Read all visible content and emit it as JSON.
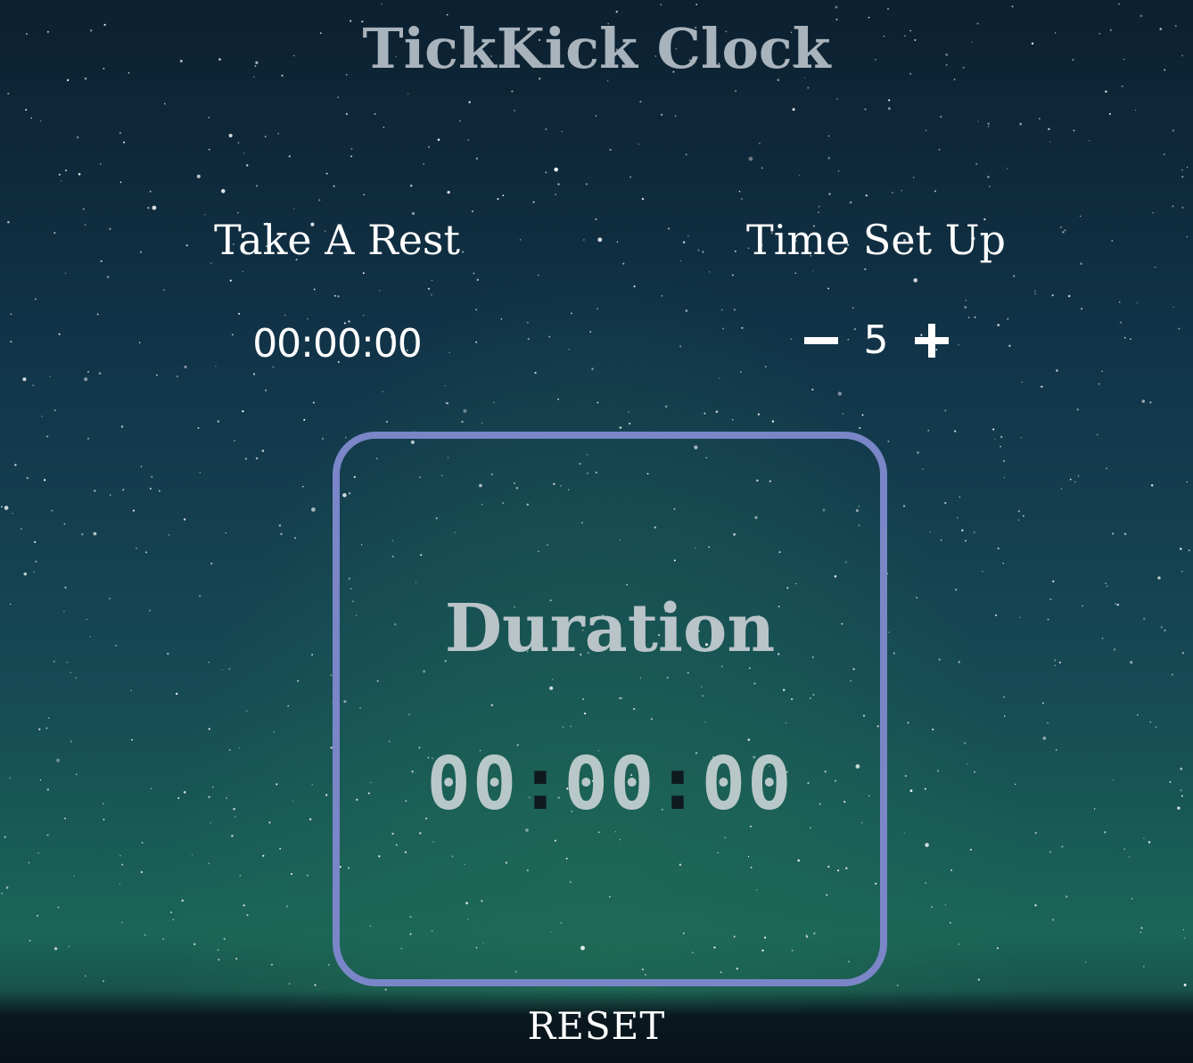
{
  "app": {
    "title": "TickKick Clock"
  },
  "rest": {
    "heading": "Take A Rest",
    "time": "00:00:00"
  },
  "setup": {
    "heading": "Time Set Up",
    "value": "5",
    "decrement_icon": "minus-icon",
    "increment_icon": "plus-icon"
  },
  "duration": {
    "label": "Duration",
    "hours": "00",
    "minutes": "00",
    "seconds": "00",
    "separator": ":"
  },
  "controls": {
    "reset_label": "RESET"
  },
  "colors": {
    "box_border": "#7a86c8",
    "title": "#a9b3bb",
    "duration_text": "#b8c4c8"
  }
}
